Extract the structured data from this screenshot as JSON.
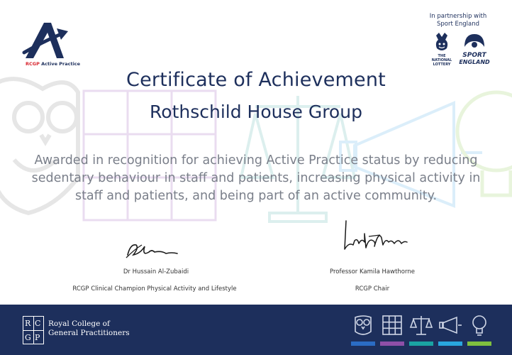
{
  "logo": {
    "text_main": "RCGP",
    "text_suffix": "Active Practice"
  },
  "partnership": {
    "text": "In partnership with Sport England",
    "lottery_label": "THE NATIONAL LOTTERY",
    "sport_england_label": "SPORT ENGLAND"
  },
  "title": "Certificate of Achievement",
  "recipient": "Rothschild House Group",
  "citation": "Awarded in recognition for achieving Active Practice status by reducing sedentary behaviour in staff and patients, increasing physical activity in staff and patients, and being part of an active community.",
  "signatories": [
    {
      "name": "Dr Hussain Al-Zubaidi",
      "role": "RCGP Clinical Champion Physical Activity and Lifestyle"
    },
    {
      "name": "Professor Kamila Hawthorne",
      "role": "RCGP Chair"
    }
  ],
  "footer": {
    "logo_letters": [
      "R",
      "C",
      "G",
      "P"
    ],
    "org_line1": "Royal College of",
    "org_line2": "General Practitioners",
    "icons": [
      {
        "name": "owl-icon",
        "color": "#2b6cc4"
      },
      {
        "name": "grid-icon",
        "color": "#8e4fa8"
      },
      {
        "name": "scales-icon",
        "color": "#1aa3a3"
      },
      {
        "name": "megaphone-icon",
        "color": "#29a6de"
      },
      {
        "name": "lightbulb-icon",
        "color": "#7fbf3f"
      }
    ]
  },
  "colors": {
    "navy": "#1d2f5c",
    "red": "#d8262f",
    "citation_grey": "#7a7f8a"
  }
}
